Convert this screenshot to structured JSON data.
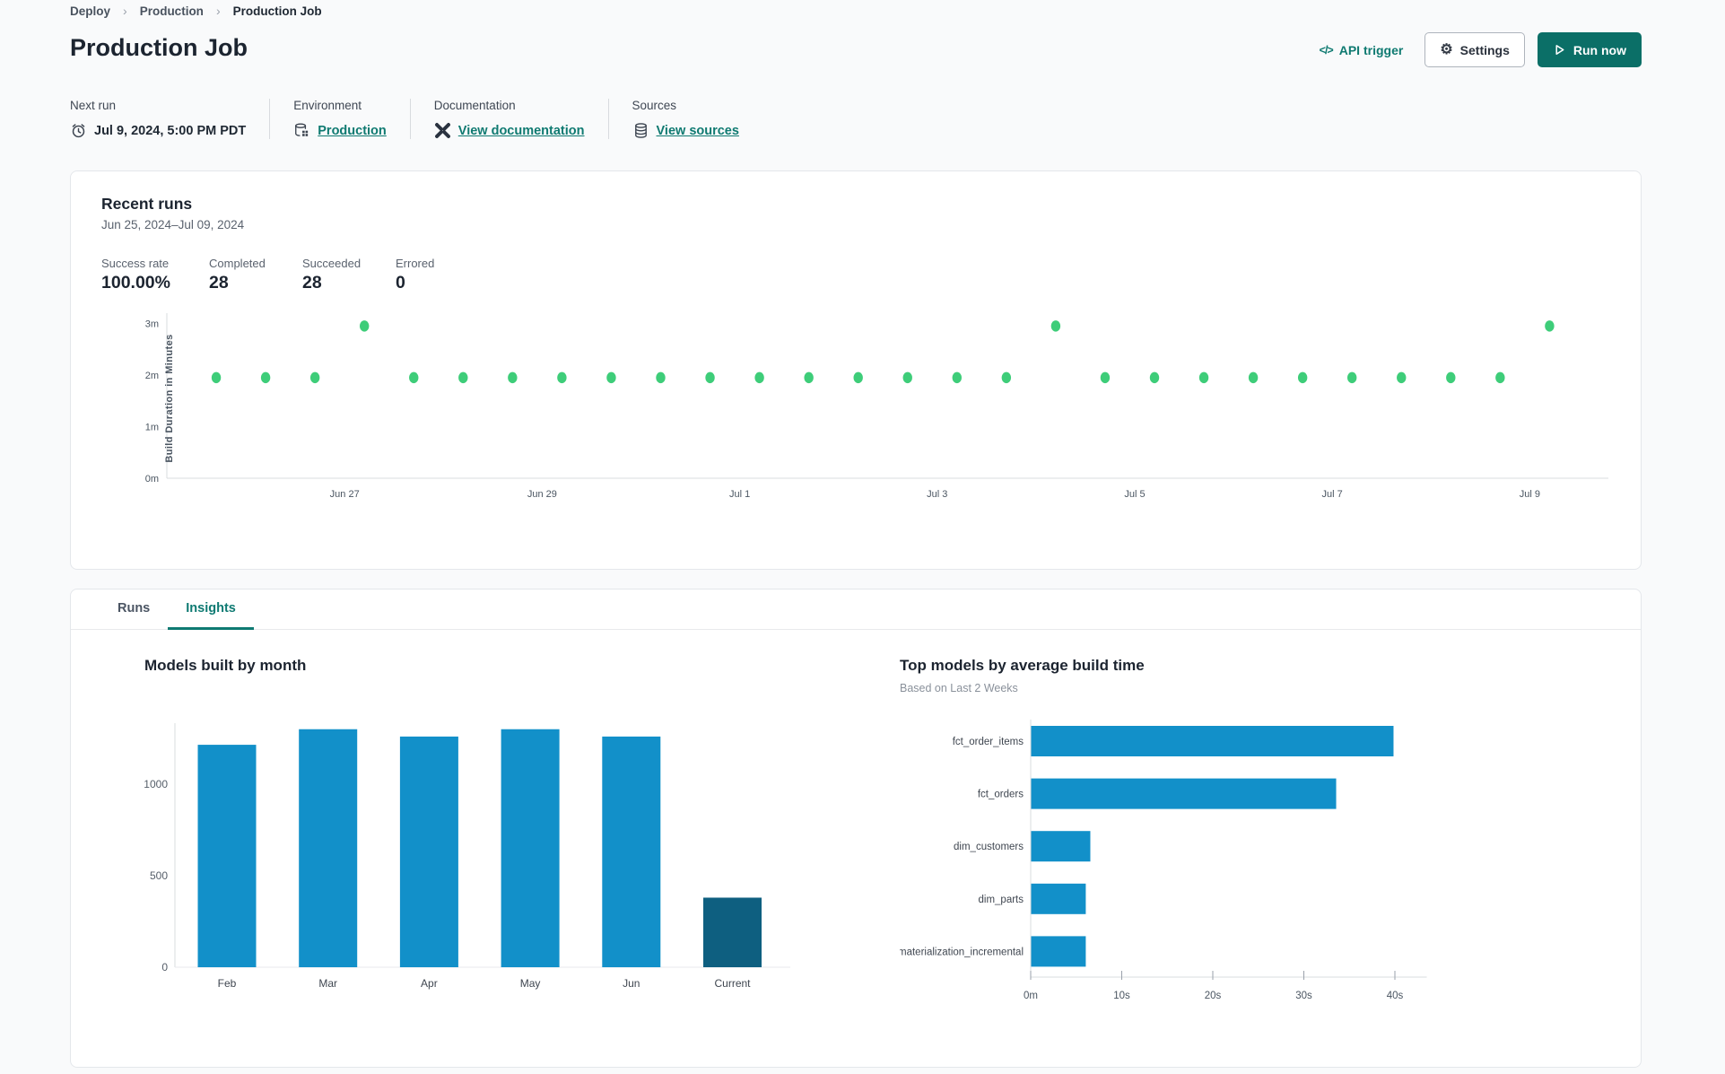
{
  "breadcrumb": {
    "items": [
      "Deploy",
      "Production",
      "Production Job"
    ]
  },
  "header": {
    "title": "Production Job",
    "api_trigger_label": "API trigger",
    "settings_label": "Settings",
    "run_now_label": "Run now"
  },
  "info_bar": {
    "sections": [
      {
        "label": "Next run",
        "value": "Jul 9, 2024, 5:00 PM PDT",
        "icon": "alarm-clock-icon",
        "is_link": false
      },
      {
        "label": "Environment",
        "value": "Production",
        "icon": "environment-database-icon",
        "is_link": true
      },
      {
        "label": "Documentation",
        "value": "View documentation",
        "icon": "dbt-docs-icon",
        "is_link": true
      },
      {
        "label": "Sources",
        "value": "View sources",
        "icon": "database-icon",
        "is_link": true
      }
    ]
  },
  "recent_runs": {
    "title": "Recent runs",
    "date_range": "Jun 25, 2024–Jul 09, 2024",
    "stats": [
      {
        "label": "Success rate",
        "value": "100.00%"
      },
      {
        "label": "Completed",
        "value": "28"
      },
      {
        "label": "Succeeded",
        "value": "28"
      },
      {
        "label": "Errored",
        "value": "0"
      }
    ]
  },
  "tabs": [
    {
      "label": "Runs",
      "active": false
    },
    {
      "label": "Insights",
      "active": true
    }
  ],
  "colors": {
    "accent_teal": "#0b6f67",
    "link_teal": "#0f7a71",
    "dot_green": "#3ecd79",
    "bar_blue": "#1290c9",
    "bar_dark_blue": "#0e5f80",
    "axis_gray": "#d9dcdf",
    "tick_text": "#4a5561"
  },
  "chart_data": [
    {
      "id": "build-duration-scatter",
      "type": "scatter",
      "ylabel": "Build Duration in Minutes",
      "y_tick_values": [
        0,
        1,
        2,
        3
      ],
      "y_tick_labels": [
        "0m",
        "1m",
        "2m",
        "3m"
      ],
      "x_tick_days": [
        2,
        4,
        6,
        8,
        10,
        12,
        14
      ],
      "x_tick_labels": [
        "Jun 27",
        "Jun 29",
        "Jul 1",
        "Jul 3",
        "Jul 5",
        "Jul 7",
        "Jul 9"
      ],
      "x_domain": [
        0.2,
        14.8
      ],
      "y_domain": [
        0,
        3.2
      ],
      "note": "28 runs, two per day, duration in minutes; day offset is from Jun 25",
      "points": [
        [
          0.7,
          1.95
        ],
        [
          1.2,
          1.95
        ],
        [
          1.7,
          1.95
        ],
        [
          2.2,
          2.95
        ],
        [
          2.7,
          1.95
        ],
        [
          3.2,
          1.95
        ],
        [
          3.7,
          1.95
        ],
        [
          4.2,
          1.95
        ],
        [
          4.7,
          1.95
        ],
        [
          5.2,
          1.95
        ],
        [
          5.7,
          1.95
        ],
        [
          6.2,
          1.95
        ],
        [
          6.7,
          1.95
        ],
        [
          7.2,
          1.95
        ],
        [
          7.7,
          1.95
        ],
        [
          8.2,
          1.95
        ],
        [
          8.7,
          1.95
        ],
        [
          9.2,
          2.95
        ],
        [
          9.7,
          1.95
        ],
        [
          10.2,
          1.95
        ],
        [
          10.7,
          1.95
        ],
        [
          11.2,
          1.95
        ],
        [
          11.7,
          1.95
        ],
        [
          12.2,
          1.95
        ],
        [
          12.7,
          1.95
        ],
        [
          13.2,
          1.95
        ],
        [
          13.7,
          1.95
        ],
        [
          14.2,
          2.95
        ]
      ]
    },
    {
      "id": "models-built-by-month",
      "type": "bar",
      "title": "Models built by month",
      "categories": [
        "Feb",
        "Mar",
        "Apr",
        "May",
        "Jun",
        "Current"
      ],
      "values": [
        1215,
        1300,
        1260,
        1300,
        1260,
        380
      ],
      "highlight_last": true,
      "y_ticks": [
        0,
        500,
        1000
      ],
      "ylim": [
        0,
        1333
      ],
      "xlabel": "",
      "ylabel": ""
    },
    {
      "id": "top-models-by-avg-build-time",
      "type": "horizontal-bar",
      "title": "Top models by average build time",
      "subtitle": "Based on Last 2 Weeks",
      "categories": [
        "fct_order_items",
        "fct_orders",
        "dim_customers",
        "dim_parts",
        "materialization_incremental"
      ],
      "values_seconds": [
        39.8,
        33.5,
        6.5,
        6.0,
        6.0
      ],
      "x_ticks": [
        {
          "v": 0,
          "label": "0m"
        },
        {
          "v": 10,
          "label": "10s"
        },
        {
          "v": 20,
          "label": "20s"
        },
        {
          "v": 30,
          "label": "30s"
        },
        {
          "v": 40,
          "label": "40s"
        }
      ],
      "xlim": [
        0,
        43.5
      ]
    }
  ]
}
